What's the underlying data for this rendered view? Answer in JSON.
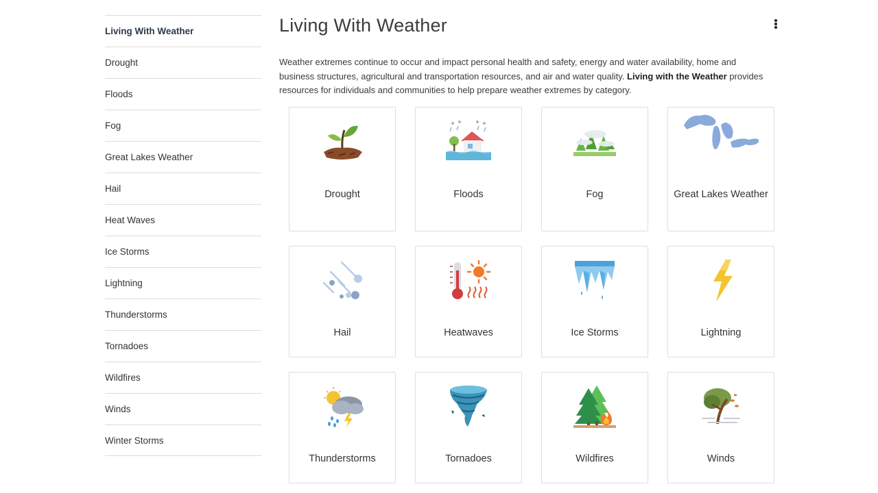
{
  "sidebar": {
    "items": [
      {
        "label": "Living With Weather",
        "active": true
      },
      {
        "label": "Drought"
      },
      {
        "label": "Floods"
      },
      {
        "label": "Fog"
      },
      {
        "label": "Great Lakes Weather"
      },
      {
        "label": "Hail"
      },
      {
        "label": "Heat Waves"
      },
      {
        "label": "Ice Storms"
      },
      {
        "label": "Lightning"
      },
      {
        "label": "Thunderstorms"
      },
      {
        "label": "Tornadoes"
      },
      {
        "label": "Wildfires"
      },
      {
        "label": "Winds"
      },
      {
        "label": "Winter Storms"
      }
    ]
  },
  "main": {
    "title": "Living With Weather",
    "intro_before": "Weather extremes continue to occur and impact personal health and safety, energy and water availability, home and business structures, agricultural and transportation resources, and air and water quality. ",
    "intro_bold": "Living with the Weather",
    "intro_after": " provides resources for individuals and communities to help prepare weather extremes by category.",
    "cards": [
      {
        "label": "Drought",
        "icon": "sprout-icon"
      },
      {
        "label": "Floods",
        "icon": "flooded-house-icon"
      },
      {
        "label": "Fog",
        "icon": "foggy-trees-icon"
      },
      {
        "label": "Great Lakes Weather",
        "icon": "great-lakes-map-icon"
      },
      {
        "label": "Hail",
        "icon": "hail-icon"
      },
      {
        "label": "Heatwaves",
        "icon": "thermometer-sun-icon"
      },
      {
        "label": "Ice Storms",
        "icon": "icicles-icon"
      },
      {
        "label": "Lightning",
        "icon": "lightning-bolt-icon"
      },
      {
        "label": "Thunderstorms",
        "icon": "storm-cloud-icon"
      },
      {
        "label": "Tornadoes",
        "icon": "tornado-icon"
      },
      {
        "label": "Wildfires",
        "icon": "forest-fire-icon"
      },
      {
        "label": "Winds",
        "icon": "windy-tree-icon"
      }
    ]
  },
  "colors": {
    "border": "#dedede",
    "text": "#333333",
    "title": "#3b3b3b",
    "active_nav": "#2d3a4a"
  }
}
